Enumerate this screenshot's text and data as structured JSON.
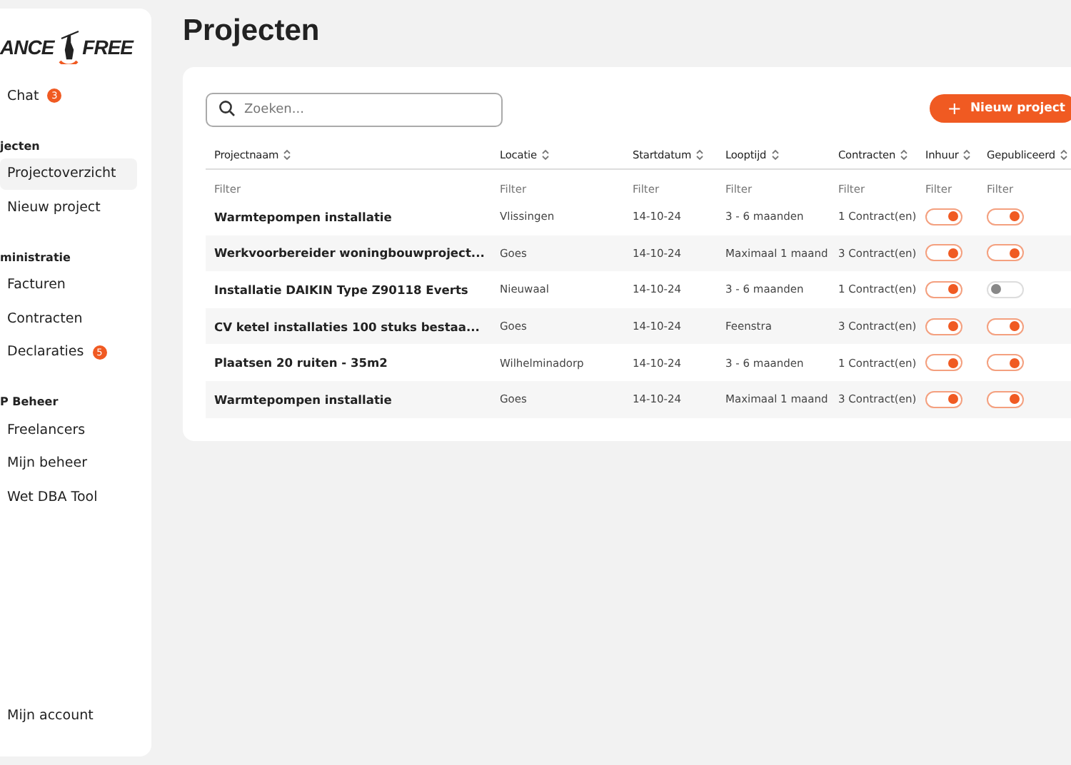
{
  "sidebar": {
    "logo": {
      "left": "ANCE",
      "right": "FREE"
    },
    "sections": [
      {
        "items": [
          {
            "label": "Chat",
            "badge": "3",
            "selected": false
          }
        ]
      },
      {
        "title": "jecten",
        "items": [
          {
            "label": "Projectoverzicht",
            "selected": true
          },
          {
            "label": "Nieuw project",
            "selected": false
          }
        ]
      },
      {
        "title": "ministratie",
        "items": [
          {
            "label": "Facturen",
            "selected": false
          },
          {
            "label": "Contracten",
            "selected": false
          },
          {
            "label": "Declaraties",
            "badge": "5",
            "selected": false
          }
        ]
      },
      {
        "title": "P Beheer",
        "items": [
          {
            "label": "Freelancers",
            "selected": false
          },
          {
            "label": "Mijn beheer",
            "selected": false
          },
          {
            "label": "Wet DBA Tool",
            "selected": false
          }
        ]
      }
    ],
    "footer_item": "Mijn account"
  },
  "page_title": "Projecten",
  "search": {
    "placeholder": "Zoeken..."
  },
  "new_button": {
    "icon": "+",
    "label": "Nieuw project"
  },
  "table": {
    "columns": [
      "Projectnaam",
      "Locatie",
      "Startdatum",
      "Looptijd",
      "Contracten",
      "Inhuur",
      "Gepubliceerd"
    ],
    "filter_placeholders": [
      "Filter",
      "Filter",
      "Filter",
      "Filter",
      "Filter",
      "Filter",
      "Filter"
    ],
    "rows": [
      {
        "name": "Warmtepompen installatie",
        "location": "Vlissingen",
        "start": "14-10-24",
        "duration": "3 - 6 maanden",
        "contracts": "1 Contract(en)",
        "hire": true,
        "published": true
      },
      {
        "name": "Werkvoorbereider woningbouwproject...",
        "location": "Goes",
        "start": "14-10-24",
        "duration": "Maximaal 1 maand",
        "contracts": "3 Contract(en)",
        "hire": true,
        "published": true
      },
      {
        "name": "Installatie DAIKIN Type Z90118 Everts",
        "location": "Nieuwaal",
        "start": "14-10-24",
        "duration": "3 - 6 maanden",
        "contracts": "1 Contract(en)",
        "hire": true,
        "published": false
      },
      {
        "name": "CV ketel installaties 100 stuks bestaa...",
        "location": "Goes",
        "start": "14-10-24",
        "duration": "Feenstra",
        "contracts": "3 Contract(en)",
        "hire": true,
        "published": true
      },
      {
        "name": "Plaatsen 20 ruiten - 35m2",
        "location": "Wilhelminadorp",
        "start": "14-10-24",
        "duration": "3 - 6 maanden",
        "contracts": "1 Contract(en)",
        "hire": true,
        "published": true
      },
      {
        "name": "Warmtepompen installatie",
        "location": "Goes",
        "start": "14-10-24",
        "duration": "Maximaal 1 maand",
        "contracts": "3 Contract(en)",
        "hire": true,
        "published": true
      }
    ]
  }
}
